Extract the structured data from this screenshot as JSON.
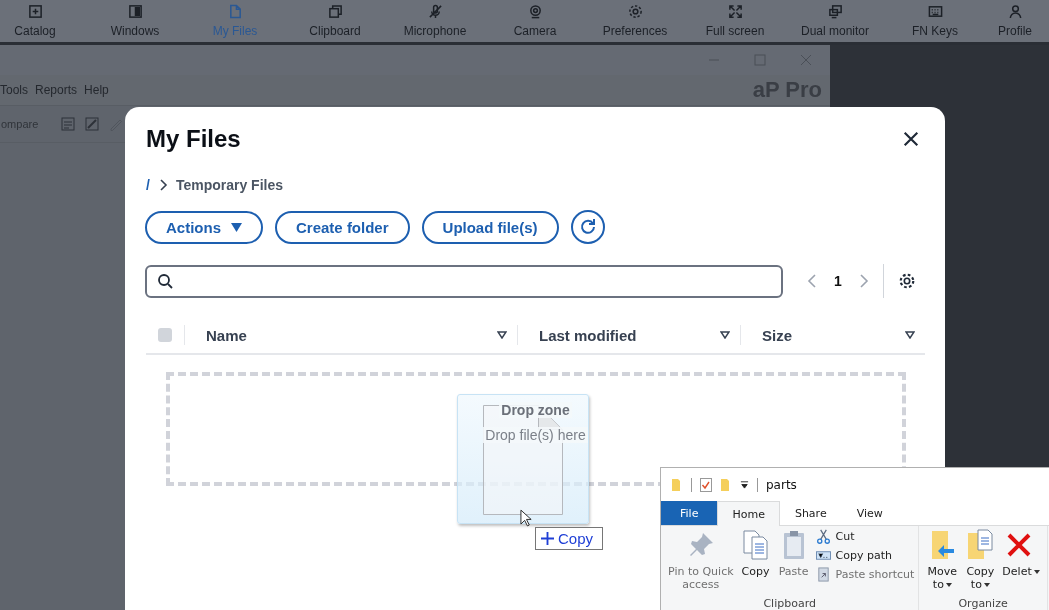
{
  "top_toolbar": {
    "items": [
      {
        "label": "Catalog",
        "selected": false
      },
      {
        "label": "Windows",
        "selected": false
      },
      {
        "label": "My Files",
        "selected": true
      },
      {
        "label": "Clipboard",
        "selected": false
      },
      {
        "label": "Microphone",
        "selected": false
      },
      {
        "label": "Camera",
        "selected": false
      },
      {
        "label": "Preferences",
        "selected": false
      },
      {
        "label": "Full screen",
        "selected": false
      },
      {
        "label": "Dual monitor",
        "selected": false
      },
      {
        "label": "FN Keys",
        "selected": false
      },
      {
        "label": "Profile",
        "selected": false
      }
    ]
  },
  "background_window": {
    "menu": [
      "Tools",
      "Reports",
      "Help"
    ],
    "logo": "aP Pro",
    "toolbar_label": "ompare"
  },
  "dialog": {
    "title": "My Files",
    "breadcrumb": {
      "root": "/",
      "current": "Temporary Files"
    },
    "actions": [
      {
        "kind": "dropdown",
        "label": "Actions"
      },
      {
        "kind": "button",
        "label": "Create folder"
      },
      {
        "kind": "button",
        "label": "Upload file(s)"
      },
      {
        "kind": "refresh"
      }
    ],
    "pager": {
      "page": "1"
    },
    "table": {
      "select_all": {
        "checked": false
      },
      "columns": [
        "Name",
        "Last modified",
        "Size"
      ]
    },
    "drop_zone": {
      "title": "Drop zone",
      "hint": "Drop file(s) here"
    }
  },
  "drag": {
    "tooltip": "Copy"
  },
  "explorer": {
    "title": "parts",
    "tabs": [
      {
        "label": "File",
        "kind": "file",
        "selected": false
      },
      {
        "label": "Home",
        "kind": "tab",
        "selected": true
      },
      {
        "label": "Share",
        "kind": "tab",
        "selected": false
      },
      {
        "label": "View",
        "kind": "tab",
        "selected": false
      }
    ],
    "groups": [
      {
        "name": "Clipboard",
        "items": [
          {
            "kind": "large",
            "label": "Pin to Quick access",
            "disabled": true
          },
          {
            "kind": "large",
            "label": "Copy",
            "disabled": false
          },
          {
            "kind": "large",
            "label": "Paste",
            "disabled": true
          },
          {
            "kind": "small",
            "label": "Cut",
            "disabled": false
          },
          {
            "kind": "small",
            "label": "Copy path",
            "disabled": false
          },
          {
            "kind": "small",
            "label": "Paste shortcut",
            "disabled": true
          }
        ]
      },
      {
        "name": "Organize",
        "items": [
          {
            "kind": "menu",
            "label": "Move to",
            "disabled": false
          },
          {
            "kind": "menu",
            "label": "Copy to",
            "disabled": false
          },
          {
            "kind": "menu",
            "label": "Delet",
            "disabled": false
          }
        ]
      }
    ]
  }
}
